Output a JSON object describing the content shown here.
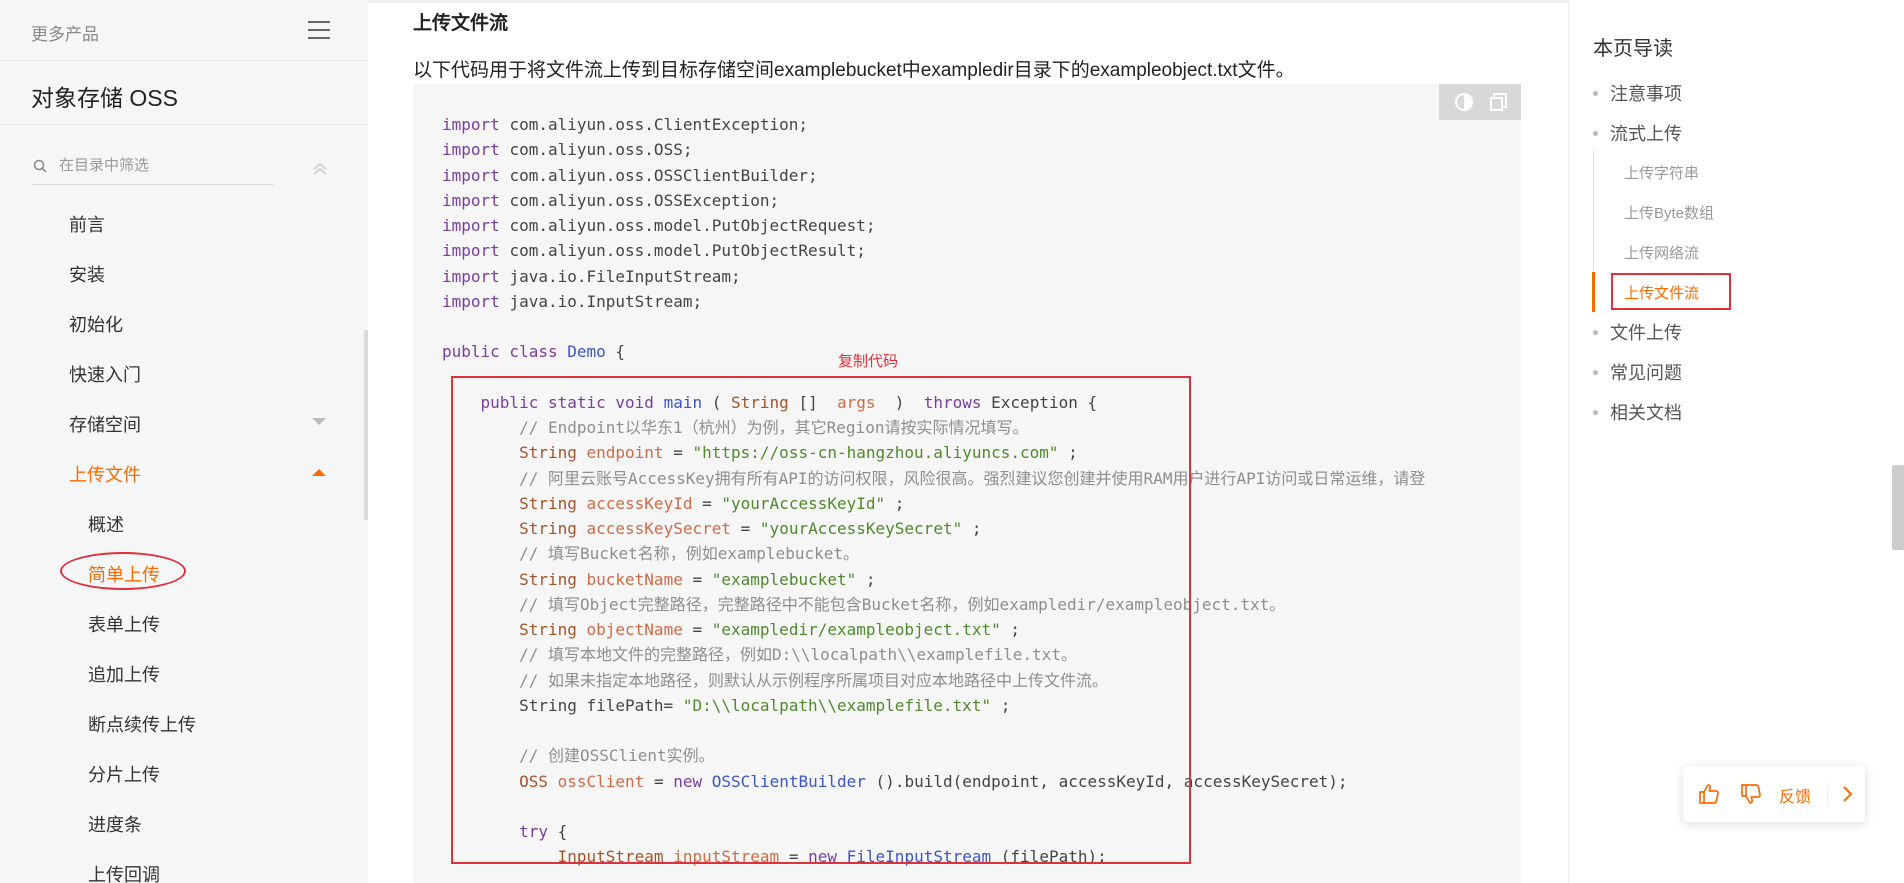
{
  "sidebar": {
    "more_products": "更多产品",
    "product_title": "对象存储 OSS",
    "filter_placeholder": "在目录中筛选",
    "items": [
      {
        "label": "前言"
      },
      {
        "label": "安装"
      },
      {
        "label": "初始化"
      },
      {
        "label": "快速入门"
      },
      {
        "label": "存储空间"
      },
      {
        "label": "上传文件"
      },
      {
        "label": "概述"
      },
      {
        "label": "简单上传"
      },
      {
        "label": "表单上传"
      },
      {
        "label": "追加上传"
      },
      {
        "label": "断点续传上传"
      },
      {
        "label": "分片上传"
      },
      {
        "label": "进度条"
      },
      {
        "label": "上传回调"
      }
    ]
  },
  "main": {
    "section_title": "上传文件流",
    "description": "以下代码用于将文件流上传到目标存储空间examplebucket中exampledir目录下的exampleobject.txt文件。",
    "copy_label": "复制代码"
  },
  "toc": {
    "title": "本页导读",
    "items": [
      {
        "label": "注意事项"
      },
      {
        "label": "流式上传"
      },
      {
        "label": "上传字符串"
      },
      {
        "label": "上传Byte数组"
      },
      {
        "label": "上传网络流"
      },
      {
        "label": "上传文件流"
      },
      {
        "label": "文件上传"
      },
      {
        "label": "常见问题"
      },
      {
        "label": "相关文档"
      }
    ]
  },
  "feedback": {
    "label": "反馈"
  },
  "code_lines": [
    [
      [
        "kw",
        "import"
      ],
      [
        "",
        "com.aliyun.oss.ClientException;"
      ]
    ],
    [
      [
        "kw",
        "import"
      ],
      [
        "",
        "com.aliyun.oss.OSS;"
      ]
    ],
    [
      [
        "kw",
        "import"
      ],
      [
        "",
        "com.aliyun.oss.OSSClientBuilder;"
      ]
    ],
    [
      [
        "kw",
        "import"
      ],
      [
        "",
        "com.aliyun.oss.OSSException;"
      ]
    ],
    [
      [
        "kw",
        "import"
      ],
      [
        "",
        "com.aliyun.oss.model.PutObjectRequest;"
      ]
    ],
    [
      [
        "kw",
        "import"
      ],
      [
        "",
        "com.aliyun.oss.model.PutObjectResult;"
      ]
    ],
    [
      [
        "kw",
        "import"
      ],
      [
        "",
        "java.io.FileInputStream;"
      ]
    ],
    [
      [
        "kw",
        "import"
      ],
      [
        "",
        "java.io.InputStream;"
      ]
    ],
    [],
    [
      [
        "kw",
        "public class"
      ],
      [
        "cls",
        "Demo"
      ],
      [
        "",
        "{"
      ]
    ],
    [],
    [
      [
        "kw",
        "    public static void"
      ],
      [
        "cls",
        "main"
      ],
      [
        "",
        "("
      ],
      [
        "ty",
        "String"
      ],
      [
        "",
        "[] "
      ],
      [
        "var",
        "args"
      ],
      [
        "",
        " ) "
      ],
      [
        "kw",
        "throws"
      ],
      [
        "",
        "Exception {"
      ]
    ],
    [
      [
        "cmt",
        "        // Endpoint以华东1（杭州）为例，其它Region请按实际情况填写。"
      ]
    ],
    [
      [
        "ty",
        "        String"
      ],
      [
        "var",
        "endpoint"
      ],
      [
        "",
        "="
      ],
      [
        "str",
        "\"https://oss-cn-hangzhou.aliyuncs.com\""
      ],
      [
        "",
        ";"
      ]
    ],
    [
      [
        "cmt",
        "        // 阿里云账号AccessKey拥有所有API的访问权限，风险很高。强烈建议您创建并使用RAM用户进行API访问或日常运维，请登"
      ]
    ],
    [
      [
        "ty",
        "        String"
      ],
      [
        "var",
        "accessKeyId"
      ],
      [
        "",
        "="
      ],
      [
        "str",
        "\"yourAccessKeyId\""
      ],
      [
        "",
        ";"
      ]
    ],
    [
      [
        "ty",
        "        String"
      ],
      [
        "var",
        "accessKeySecret"
      ],
      [
        "",
        "="
      ],
      [
        "str",
        "\"yourAccessKeySecret\""
      ],
      [
        "",
        ";"
      ]
    ],
    [
      [
        "cmt",
        "        // 填写Bucket名称，例如examplebucket。"
      ]
    ],
    [
      [
        "ty",
        "        String"
      ],
      [
        "var",
        "bucketName"
      ],
      [
        "",
        "="
      ],
      [
        "str",
        "\"examplebucket\""
      ],
      [
        "",
        ";"
      ]
    ],
    [
      [
        "cmt",
        "        // 填写Object完整路径，完整路径中不能包含Bucket名称，例如exampledir/exampleobject.txt。"
      ]
    ],
    [
      [
        "ty",
        "        String"
      ],
      [
        "var",
        "objectName"
      ],
      [
        "",
        "="
      ],
      [
        "str",
        "\"exampledir/exampleobject.txt\""
      ],
      [
        "",
        ";"
      ]
    ],
    [
      [
        "cmt",
        "        // 填写本地文件的完整路径，例如D:\\\\localpath\\\\examplefile.txt。"
      ]
    ],
    [
      [
        "cmt",
        "        // 如果未指定本地路径，则默认从示例程序所属项目对应本地路径中上传文件流。"
      ]
    ],
    [
      [
        "",
        "        String filePath="
      ],
      [
        "str",
        "\"D:\\\\localpath\\\\examplefile.txt\""
      ],
      [
        "",
        ";"
      ]
    ],
    [],
    [
      [
        "cmt",
        "        // 创建OSSClient实例。"
      ]
    ],
    [
      [
        "ty",
        "        OSS"
      ],
      [
        "var",
        "ossClient"
      ],
      [
        "",
        "="
      ],
      [
        "kw",
        "new"
      ],
      [
        "cls",
        "OSSClientBuilder"
      ],
      [
        "",
        "().build(endpoint, accessKeyId, accessKeySecret);"
      ]
    ],
    [],
    [
      [
        "kw",
        "        try"
      ],
      [
        "",
        "{"
      ]
    ],
    [
      [
        "ty",
        "            InputStream"
      ],
      [
        "var",
        "inputStream"
      ],
      [
        "",
        "="
      ],
      [
        "kw",
        "new"
      ],
      [
        "cls",
        "FileInputStream"
      ],
      [
        "",
        "(filePath);"
      ]
    ]
  ],
  "colors": {
    "accent": "#ff6a00",
    "annotation_red": "#e0303a"
  }
}
